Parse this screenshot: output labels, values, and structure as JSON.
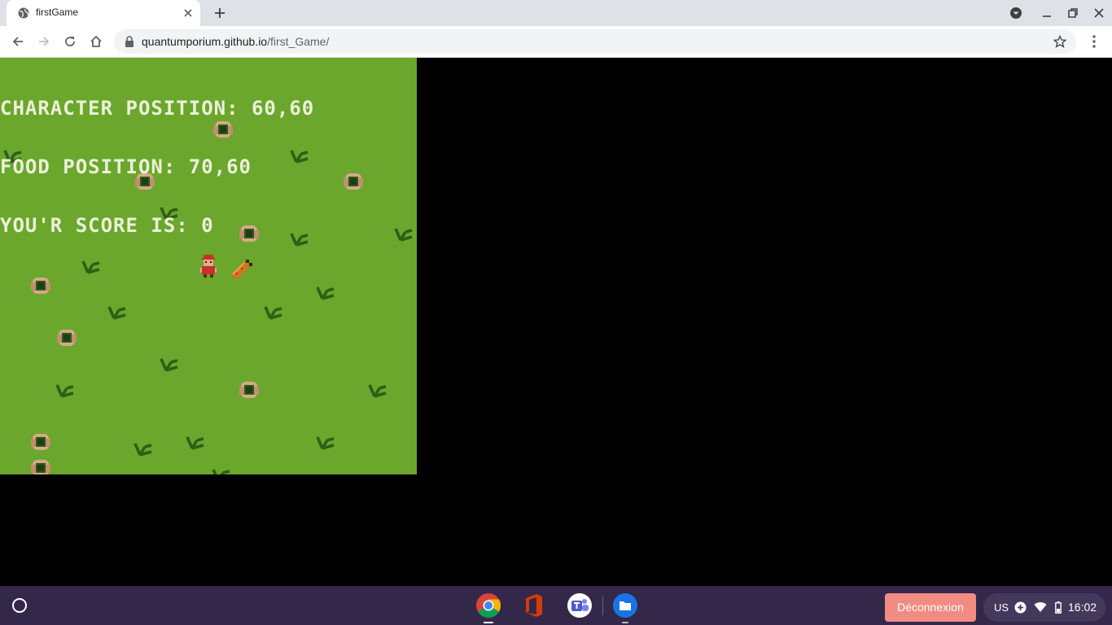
{
  "browser": {
    "tab_title": "firstGame",
    "url_host": "quantumporium.github.io",
    "url_path": "/first_Game/"
  },
  "game": {
    "hud_line1": "CHARACTER POSITION: 60,60",
    "hud_line2": "FOOD POSITION: 70,60",
    "hud_line3": "YOU'R SCORE IS: 0"
  },
  "shelf": {
    "logout_label": "Déconnexion",
    "ime_label": "US",
    "clock": "16:02",
    "apps": [
      "chrome-icon",
      "office-icon",
      "teams-icon",
      "files-icon"
    ]
  },
  "colors": {
    "grass": "#6aa72c",
    "hud_text": "#ecf0d8",
    "shelf_bg": "#33284a",
    "logout_bg": "#f28b82"
  }
}
